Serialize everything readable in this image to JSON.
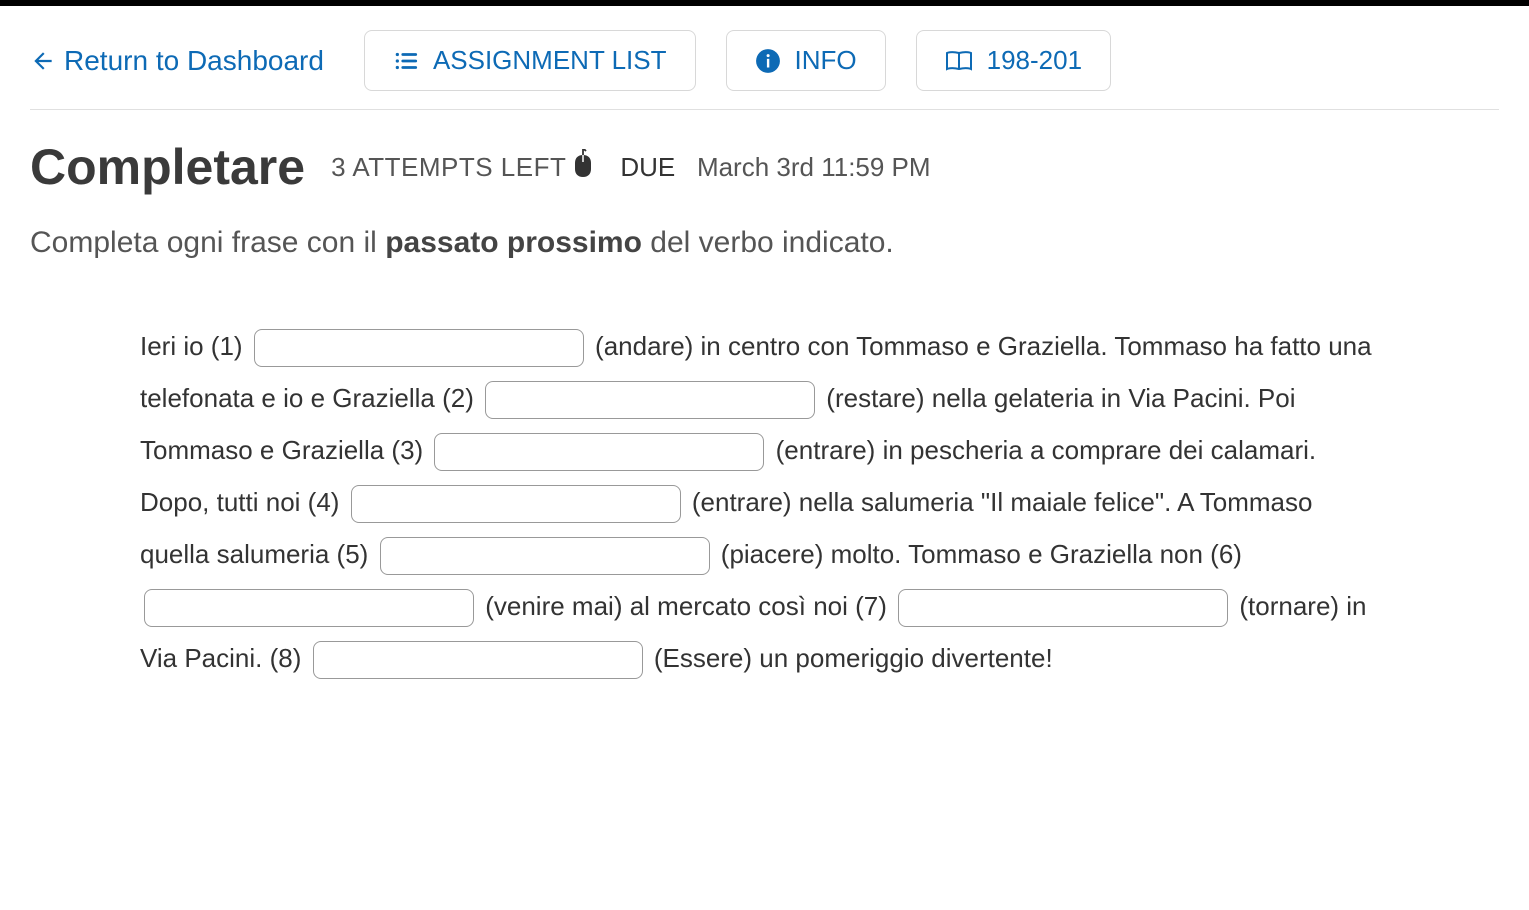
{
  "header": {
    "return": "Return to Dashboard",
    "buttons": {
      "assignment_list": "ASSIGNMENT LIST",
      "info": "INFO",
      "pages": "198-201"
    }
  },
  "title": "Completare",
  "attempts": "3 ATTEMPTS LEFT",
  "due_label": "DUE",
  "due_time": "March 3rd 11:59 PM",
  "instructions_pre": "Completa ogni frase con il ",
  "instructions_bold": "passato prossimo",
  "instructions_post": " del verbo indicato.",
  "paragraph": {
    "t1": "Ieri io (1) ",
    "v1": "",
    "t2": " (andare) in centro con Tommaso e Graziella. Tommaso ha fatto una telefonata e io e Graziella (2) ",
    "v2": "",
    "t3": " (restare) nella gelateria in Via Pacini. Poi Tommaso e Graziella (3) ",
    "v3": "",
    "t4": " (entrare) in pescheria a comprare dei calamari. Dopo, tutti noi (4) ",
    "v4": "",
    "t5": " (entrare) nella salumeria \"Il maiale felice\". A Tommaso quella salumeria (5) ",
    "v5": "",
    "t6": " (piacere) molto. Tommaso e Graziella non (6) ",
    "v6": "",
    "t7": " (venire mai) al mercato così noi (7) ",
    "v7": "",
    "t8": " (tornare) in Via Pacini. (8) ",
    "v8": "",
    "t9": " (Essere) un pomeriggio divertente!"
  }
}
